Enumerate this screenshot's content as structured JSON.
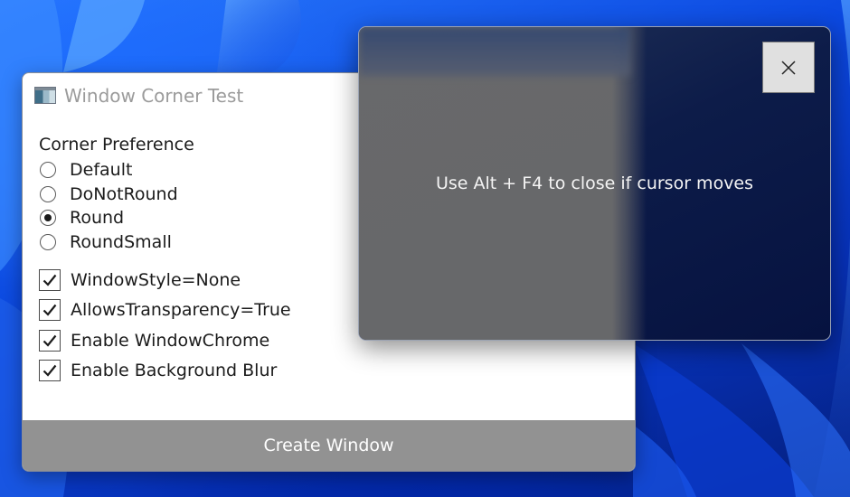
{
  "main_window": {
    "title": "Window Corner Test",
    "corner_preference": {
      "label": "Corner Preference",
      "options": [
        {
          "label": "Default",
          "selected": false
        },
        {
          "label": "DoNotRound",
          "selected": false
        },
        {
          "label": "Round",
          "selected": true
        },
        {
          "label": "RoundSmall",
          "selected": false
        }
      ]
    },
    "checkboxes": [
      {
        "label": "WindowStyle=None",
        "checked": true
      },
      {
        "label": "AllowsTransparency=True",
        "checked": true
      },
      {
        "label": "Enable WindowChrome",
        "checked": true
      },
      {
        "label": "Enable Background Blur",
        "checked": true
      }
    ],
    "create_button_label": "Create Window"
  },
  "overlay_window": {
    "message": "Use Alt + F4 to close if cursor moves",
    "close_icon": "close-icon"
  },
  "colors": {
    "create_button_bg": "#929292",
    "overlay_dark": "#0d1c49",
    "desktop_accent": "#0b48e0"
  }
}
